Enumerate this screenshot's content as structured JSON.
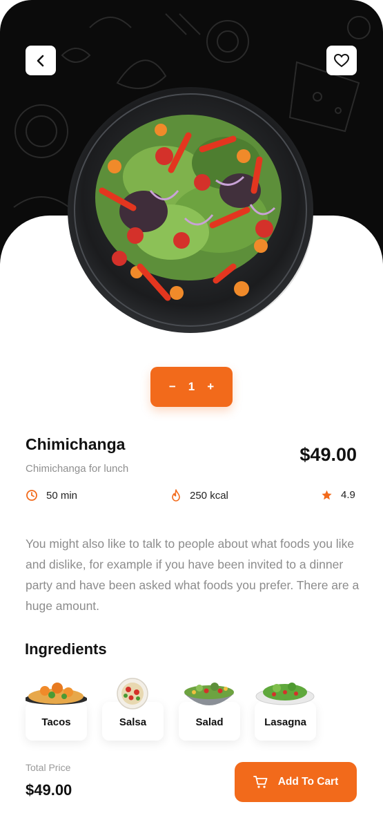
{
  "header": {
    "back_icon": "chevron-left-icon",
    "favorite_icon": "heart-icon"
  },
  "quantity": {
    "minus_label": "−",
    "value": "1",
    "plus_label": "+"
  },
  "product": {
    "name": "Chimichanga",
    "subtitle": "Chimichanga for lunch",
    "price": "$49.00",
    "time": "50 min",
    "calories": "250 kcal",
    "rating": "4.9",
    "description": "You might also like to talk to people about what foods you like and dislike, for example if you have been invited to a dinner party and have been asked what foods you prefer. There are a huge amount."
  },
  "ingredients": {
    "title": "Ingredients",
    "items": [
      {
        "name": "Tacos"
      },
      {
        "name": "Salsa"
      },
      {
        "name": "Salad"
      },
      {
        "name": "Lasagna"
      }
    ]
  },
  "footer": {
    "total_label": "Total Price",
    "total_price": "$49.00",
    "cart_label": "Add To Cart",
    "cart_icon": "cart-icon"
  },
  "colors": {
    "accent": "#F26A1B",
    "hero_bg": "#0B0B0B"
  }
}
